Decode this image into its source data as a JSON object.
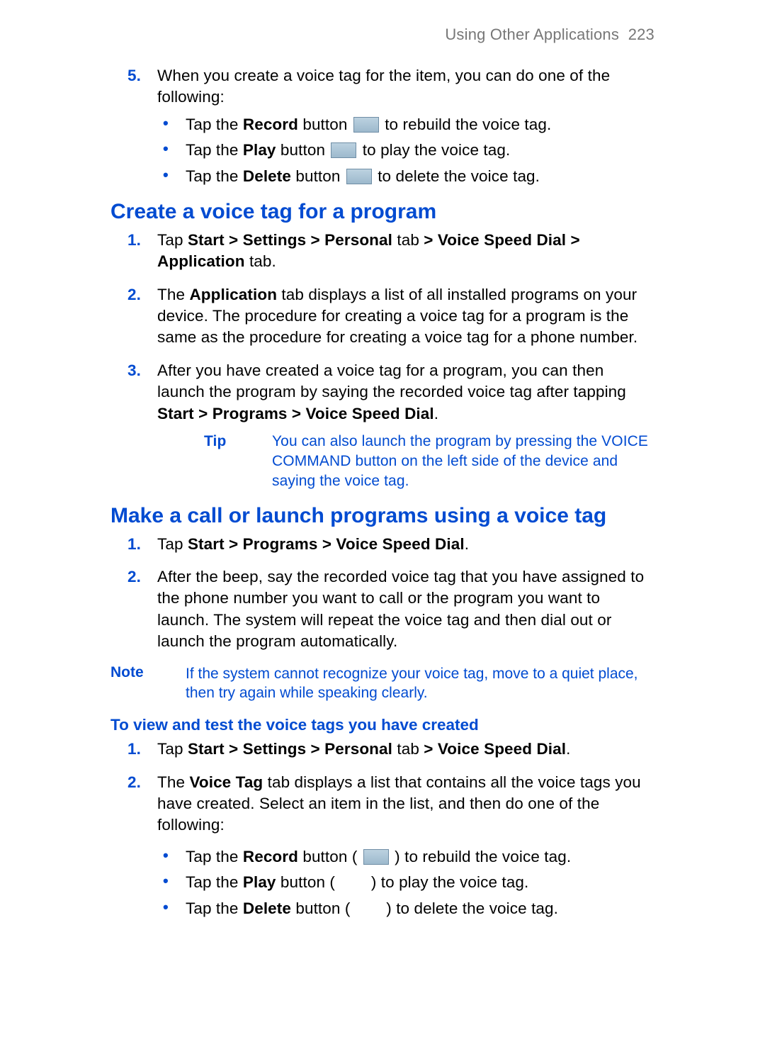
{
  "header": {
    "section": "Using Other Applications",
    "page_num": "223"
  },
  "intro_list_start": 4,
  "intro_step5": {
    "text": "When you create a voice tag for the item, you can do one of the following:",
    "bullets": {
      "b1_pre": "Tap the ",
      "b1_bold": "Record",
      "b1_mid": " button ",
      "b1_post": " to rebuild the voice tag.",
      "b2_pre": "Tap the ",
      "b2_bold": "Play",
      "b2_mid": " button ",
      "b2_post": " to play the voice tag.",
      "b3_pre": "Tap the ",
      "b3_bold": "Delete",
      "b3_mid": " button ",
      "b3_post": " to delete the voice tag."
    }
  },
  "sectionA": {
    "title": "Create a voice tag for a program",
    "s1_pre": "Tap ",
    "s1_b1": "Start > Settings > Personal",
    "s1_mid1": " tab ",
    "s1_b2": "> Voice Speed Dial > Application",
    "s1_post": " tab.",
    "s2_pre": "The ",
    "s2_b": "Application",
    "s2_post": " tab displays a list of all installed programs on your device. The procedure for creating a voice tag for a program is the same as the procedure for creating a voice tag for a phone number.",
    "s3_pre": "After you have created a voice tag for a program, you can then launch the program by saying the recorded voice tag after tapping ",
    "s3_b": "Start > Programs > Voice Speed Dial",
    "s3_post": ".",
    "tip_label": "Tip",
    "tip_body": "You can also launch the program by pressing the VOICE COMMAND button on the left side of the device and saying the voice tag."
  },
  "sectionB": {
    "title": "Make a call or launch programs using a voice tag",
    "s1_pre": "Tap ",
    "s1_b": "Start > Programs > Voice Speed Dial",
    "s1_post": ".",
    "s2": "After the beep, say the recorded voice tag that you have assigned to the phone number you want to call or the program you want to launch. The system will repeat the voice tag and then dial out or launch the program automatically.",
    "note_label": "Note",
    "note_body": "If the system cannot recognize your voice tag, move to a quiet place, then try again while speaking clearly."
  },
  "sectionC": {
    "title": "To view and test the voice tags you have created",
    "s1_pre": "Tap ",
    "s1_b1": "Start > Settings > Personal",
    "s1_mid": " tab ",
    "s1_b2": "> Voice Speed Dial",
    "s1_post": ".",
    "s2_pre": "The ",
    "s2_b": "Voice Tag",
    "s2_post": " tab displays a list that contains all the voice tags you have created. Select an item in the list, and then do one of the following:",
    "bullets": {
      "b1_pre": "Tap the ",
      "b1_bold": "Record",
      "b1_mid": " button ( ",
      "b1_post": " ) to rebuild the voice tag.",
      "b2_pre": "Tap the ",
      "b2_bold": "Play",
      "b2_mid": " button (",
      "b2_gap": "        ",
      "b2_post": ") to play the voice tag.",
      "b3_pre": "Tap the ",
      "b3_bold": "Delete",
      "b3_mid": " button (",
      "b3_gap": "        ",
      "b3_post": ") to delete the voice tag."
    }
  }
}
